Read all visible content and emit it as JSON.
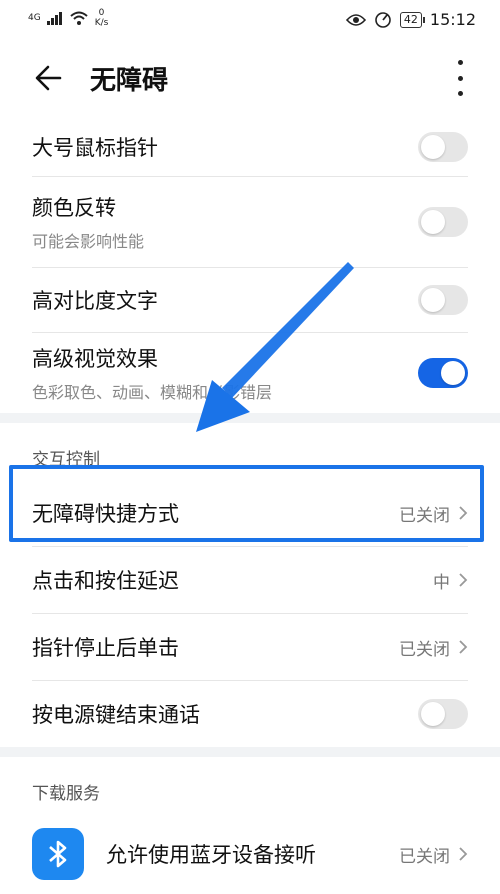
{
  "status": {
    "signal": "4G",
    "speed_value": "0",
    "speed_unit": "K/s",
    "battery": "42",
    "time": "15:12"
  },
  "header": {
    "title": "无障碍"
  },
  "settings": [
    {
      "label": "大号鼠标指针",
      "type": "toggle",
      "on": false
    },
    {
      "label": "颜色反转",
      "sub": "可能会影响性能",
      "type": "toggle",
      "on": false
    },
    {
      "label": "高对比度文字",
      "type": "toggle",
      "on": false
    },
    {
      "label": "高级视觉效果",
      "sub": "色彩取色、动画、模糊和光影错层",
      "type": "toggle",
      "on": true
    }
  ],
  "section_interaction": {
    "title": "交互控制",
    "items": [
      {
        "label": "无障碍快捷方式",
        "value": "已关闭"
      },
      {
        "label": "点击和按住延迟",
        "value": "中"
      },
      {
        "label": "指针停止后单击",
        "value": "已关闭"
      },
      {
        "label": "按电源键结束通话",
        "type": "toggle",
        "on": false
      }
    ]
  },
  "section_download": {
    "title": "下载服务",
    "items": [
      {
        "label": "允许使用蓝牙设备接听",
        "value": "已关闭",
        "icon": "bluetooth-icon"
      }
    ]
  },
  "colors": {
    "accent": "#1565e5",
    "highlight": "#1a73e8"
  }
}
